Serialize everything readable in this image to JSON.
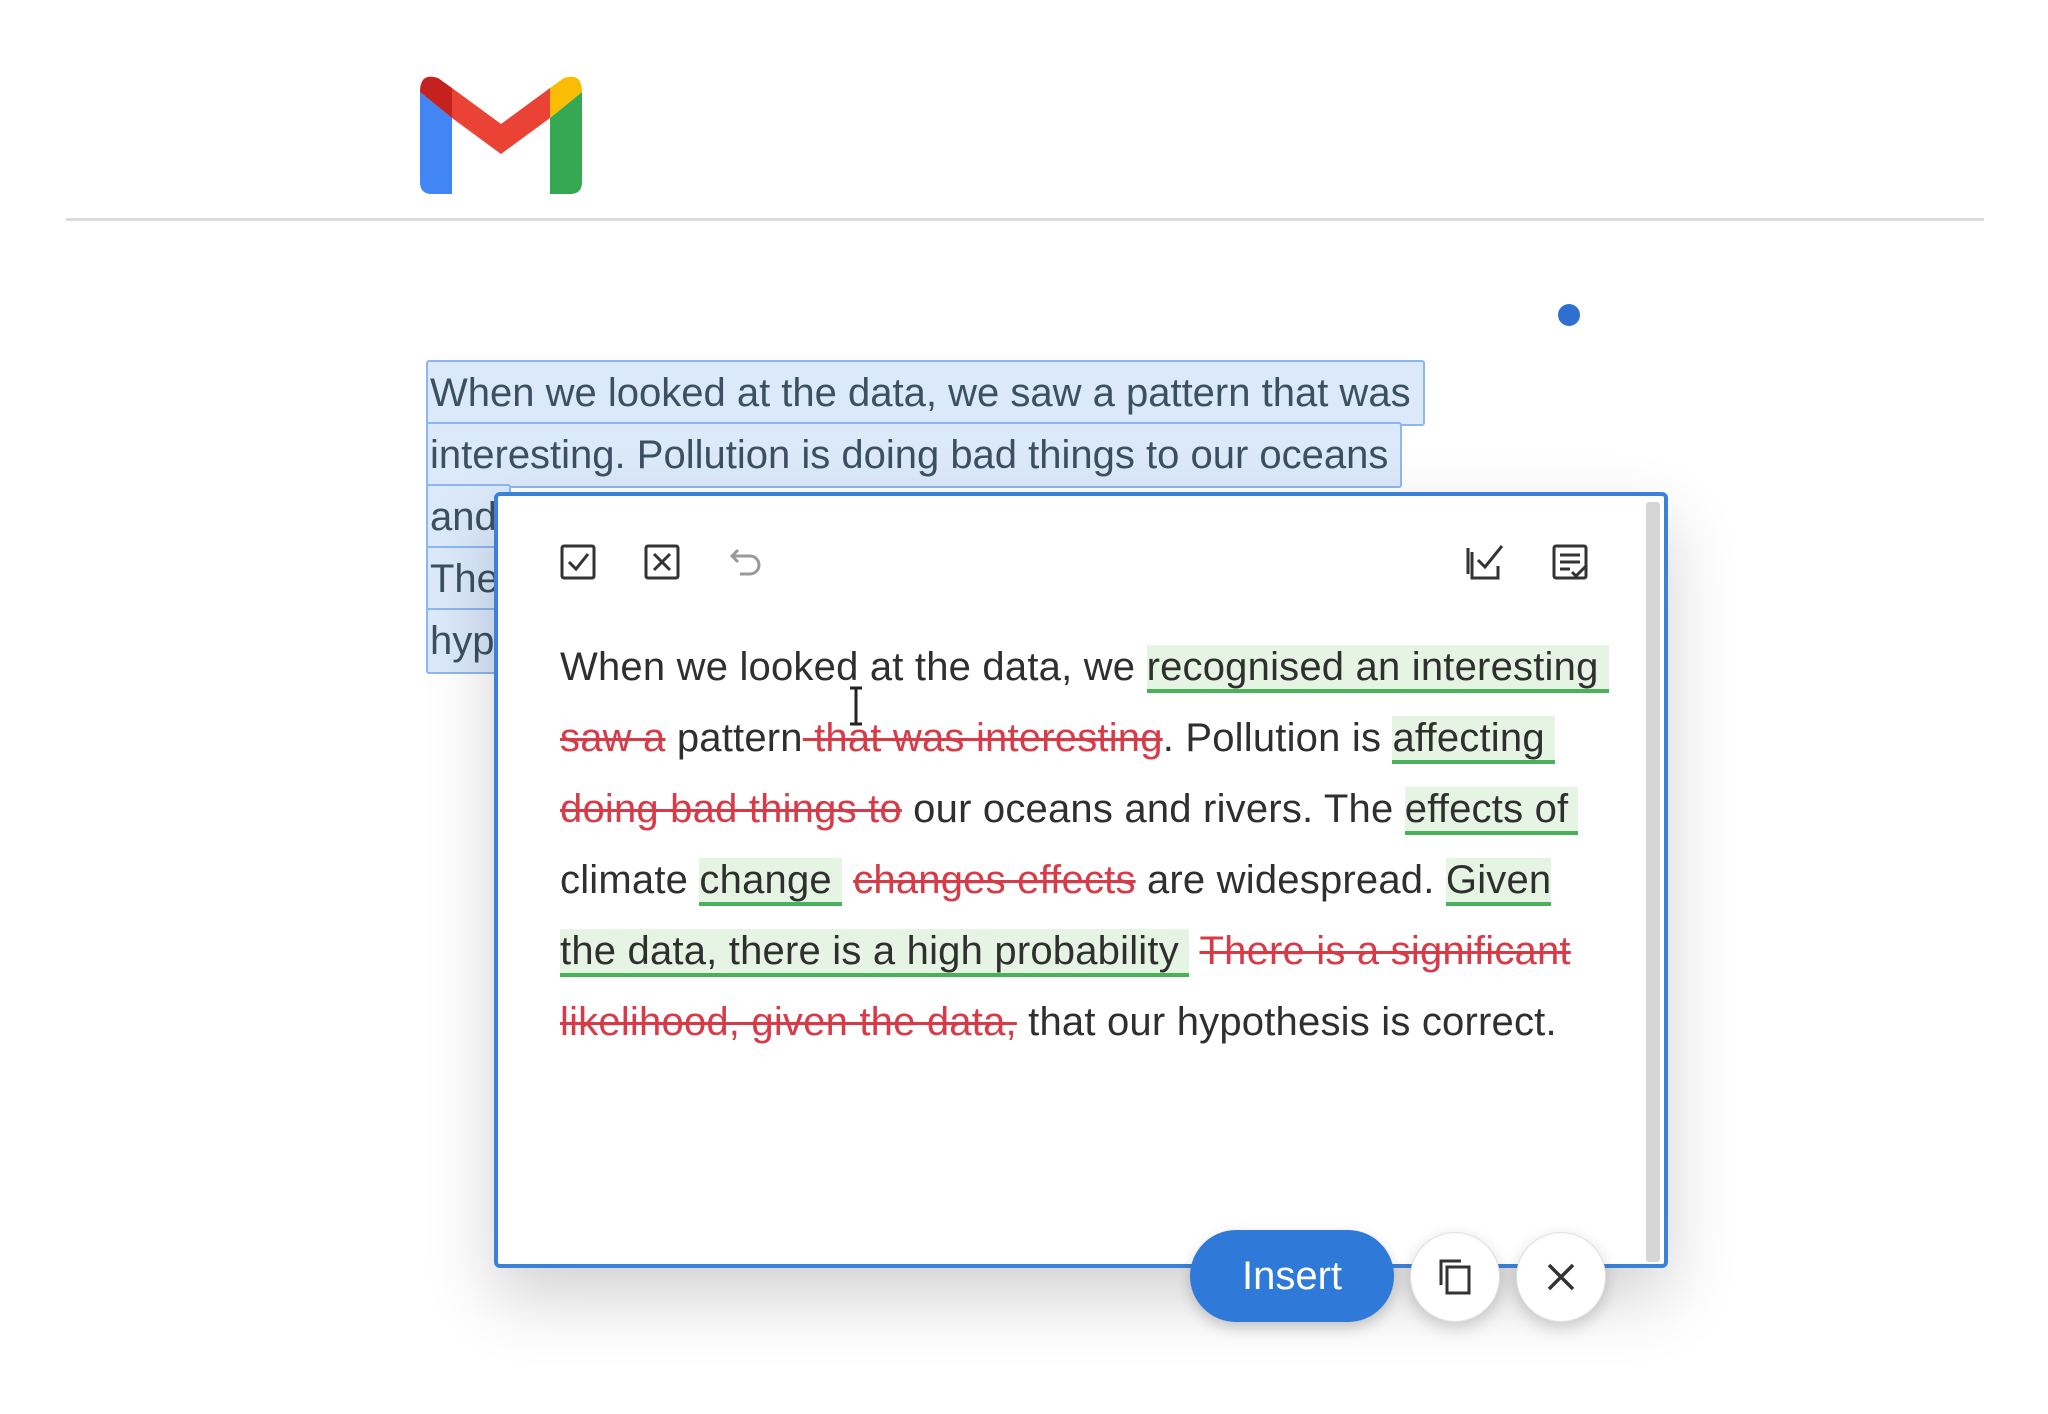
{
  "app": {
    "logo": "gmail-logo"
  },
  "selection": {
    "lines": [
      "When we looked at the data, we saw a pattern that was",
      "interesting. Pollution is doing bad things to our oceans",
      "and",
      "The",
      "hyp"
    ]
  },
  "toolbar": {
    "left_icons": [
      "accept-all-icon",
      "reject-all-icon",
      "undo-icon"
    ],
    "right_icons": [
      "accept-checklist-icon",
      "review-list-icon"
    ]
  },
  "rewrite": {
    "segments": [
      {
        "t": "When we looked at the data, we ",
        "k": "plain"
      },
      {
        "t": "recognised an interesting",
        "k": "ins"
      },
      {
        "t": " ",
        "k": "plain"
      },
      {
        "t": "saw a",
        "k": "del"
      },
      {
        "t": " pattern",
        "k": "plain"
      },
      {
        "t": " that was interesting",
        "k": "del"
      },
      {
        "t": ". Pollution is ",
        "k": "plain"
      },
      {
        "t": "affecting",
        "k": "ins"
      },
      {
        "t": " ",
        "k": "plain"
      },
      {
        "t": "doing bad things to",
        "k": "del"
      },
      {
        "t": " our oceans and rivers. The ",
        "k": "plain"
      },
      {
        "t": "effects of",
        "k": "ins"
      },
      {
        "t": " climate ",
        "k": "plain"
      },
      {
        "t": "change",
        "k": "ins"
      },
      {
        "t": " ",
        "k": "plain"
      },
      {
        "t": "changes effects",
        "k": "del"
      },
      {
        "t": " are widespread. ",
        "k": "plain"
      },
      {
        "t": "Given the data, there is a high probability",
        "k": "ins"
      },
      {
        "t": " ",
        "k": "plain"
      },
      {
        "t": "There is a significant likelihood, given the data,",
        "k": "del"
      },
      {
        "t": " that our hypothesis is correct.",
        "k": "plain"
      }
    ]
  },
  "actions": {
    "insert_label": "Insert",
    "copy_icon": "copy-icon",
    "close_icon": "close-icon"
  },
  "colors": {
    "accent": "#2f7ad8",
    "inserted_bg": "#e6f4e3",
    "inserted_underline": "#49b15a",
    "deleted": "#d73b48",
    "selection_bg": "#dbe9fb"
  }
}
